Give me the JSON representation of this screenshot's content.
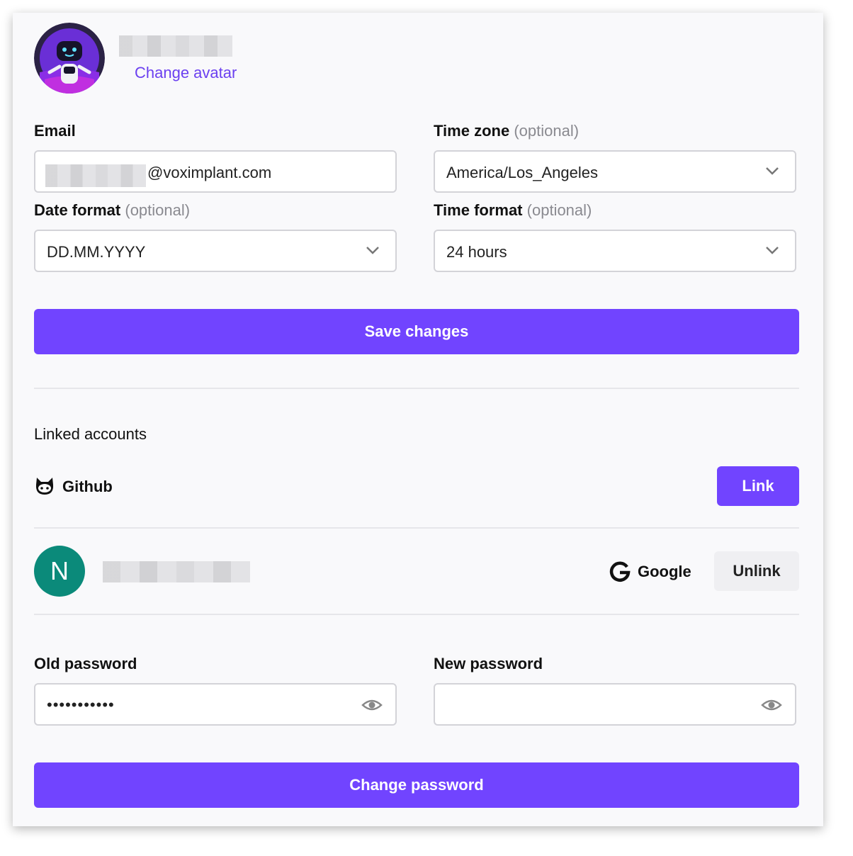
{
  "profile": {
    "change_avatar": "Change avatar"
  },
  "email": {
    "label": "Email",
    "value_suffix": "@voximplant.com"
  },
  "timezone": {
    "label": "Time zone",
    "optional": "(optional)",
    "value": "America/Los_Angeles"
  },
  "date_format": {
    "label": "Date format",
    "optional": "(optional)",
    "value": "DD.MM.YYYY"
  },
  "time_format": {
    "label": "Time format",
    "optional": "(optional)",
    "value": "24 hours"
  },
  "save_button": "Save changes",
  "linked": {
    "title": "Linked accounts",
    "github": {
      "name": "Github",
      "button": "Link"
    },
    "google": {
      "avatar_letter": "N",
      "provider": "Google",
      "button": "Unlink"
    }
  },
  "password": {
    "old_label": "Old password",
    "old_value": "•••••••••••",
    "new_label": "New password",
    "new_value": "",
    "button": "Change password"
  },
  "colors": {
    "accent": "#7144ff",
    "link": "#6b40f0",
    "avatar_bg": "#0b8a7a"
  },
  "icons": [
    "chevron-down-icon",
    "eye-icon",
    "github-icon",
    "google-icon",
    "robot-avatar"
  ]
}
